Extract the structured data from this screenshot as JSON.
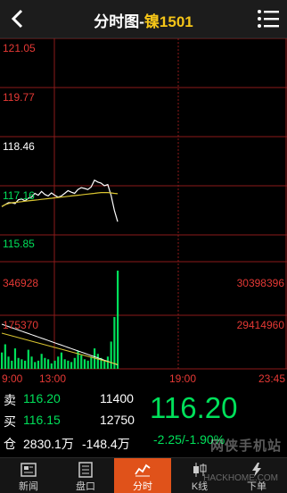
{
  "header": {
    "title_prefix": "分时图-",
    "title_name": "镍",
    "title_code": "1501",
    "back_icon": "chevron-left-icon",
    "menu_icon": "list-menu-icon"
  },
  "price_axis": {
    "labels": [
      "121.05",
      "119.77",
      "118.46",
      "117.16",
      "115.85"
    ]
  },
  "volume_axis": {
    "left_labels": [
      "346928",
      "175370"
    ],
    "right_labels": [
      "30398396",
      "29414960"
    ]
  },
  "time_axis": {
    "labels": [
      "9:00",
      "13:00",
      "19:00",
      "23:45"
    ]
  },
  "chart_data": {
    "type": "line",
    "title": "",
    "x_range": [
      "9:00",
      "23:45"
    ],
    "price_ylim": [
      115.85,
      121.05
    ],
    "series": [
      {
        "values": [
          116.6,
          116.65,
          116.7,
          116.7,
          116.68,
          116.78,
          116.8,
          116.75,
          116.82,
          116.85,
          116.95,
          116.9,
          117.0,
          116.92,
          116.88,
          116.96,
          116.9,
          116.85,
          116.88,
          116.95,
          117.02,
          116.98,
          116.95,
          117.05,
          117.1,
          117.08,
          117.05,
          117.12,
          117.3,
          117.25,
          117.22,
          117.15,
          117.18,
          116.9,
          116.5,
          116.2
        ]
      },
      {
        "values": [
          116.6,
          116.65,
          116.68,
          116.7,
          116.71,
          116.72,
          116.73,
          116.74,
          116.75,
          116.76,
          116.77,
          116.78,
          116.79,
          116.8,
          116.81,
          116.82,
          116.83,
          116.84,
          116.85,
          116.86,
          116.87,
          116.88,
          116.89,
          116.9,
          116.91,
          116.92,
          116.93,
          116.94,
          116.95,
          116.96,
          116.97,
          116.97,
          116.97,
          116.96,
          116.95,
          116.94
        ]
      }
    ],
    "volume": [
      120,
      180,
      90,
      60,
      150,
      80,
      70,
      60,
      140,
      90,
      50,
      60,
      110,
      80,
      70,
      40,
      60,
      90,
      120,
      70,
      60,
      50,
      80,
      130,
      100,
      70,
      60,
      90,
      150,
      110,
      80,
      60,
      90,
      200,
      380,
      720
    ],
    "open_interest_ylim": [
      29414960,
      30398396
    ]
  },
  "quote": {
    "sell_label": "卖",
    "sell_price": "116.20",
    "sell_qty": "11400",
    "buy_label": "买",
    "buy_price": "116.15",
    "buy_qty": "12750",
    "oi_label": "仓",
    "oi_value": "2830.1万",
    "oi_change": "-148.4万",
    "last_price": "116.20",
    "change": "-2.25/-1.90%"
  },
  "tabs": [
    {
      "label": "新闻",
      "icon": "news-icon"
    },
    {
      "label": "盘口",
      "icon": "orderbook-icon"
    },
    {
      "label": "分时",
      "icon": "intraday-chart-icon"
    },
    {
      "label": "K线",
      "icon": "candlestick-icon"
    },
    {
      "label": "下单",
      "icon": "lightning-order-icon"
    }
  ],
  "watermark": {
    "main": "网侠手机站",
    "sub": "HACKHOME.COM"
  },
  "colors": {
    "accent": "#e0521a",
    "up_red": "#e53935",
    "down_green": "#00e05a",
    "price_line": "#ffffff",
    "avg_line": "#d8c330",
    "grid": "#8b1a1a"
  }
}
